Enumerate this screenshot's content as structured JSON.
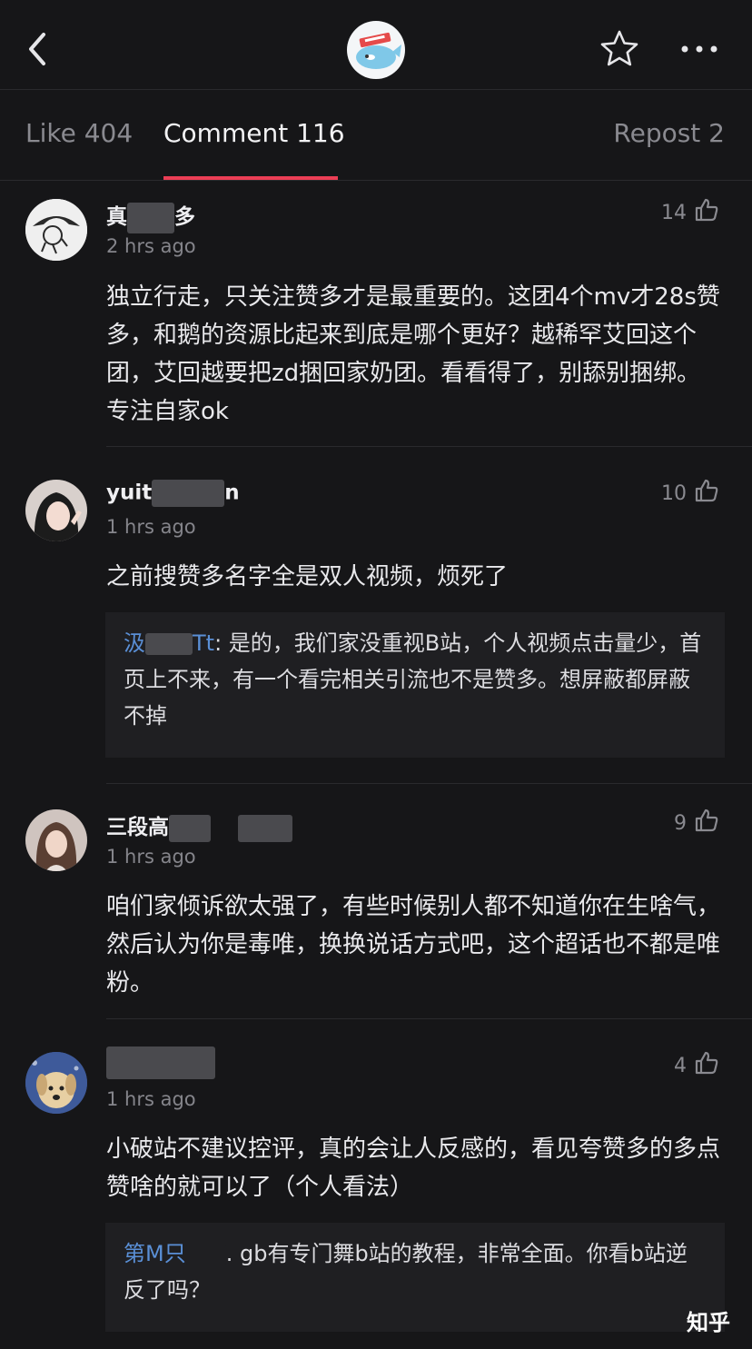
{
  "tabs": {
    "like": "Like 404",
    "comment": "Comment 116",
    "repost": "Repost 2"
  },
  "comments": [
    {
      "name_start": "真",
      "name_end": "多",
      "time": "2 hrs ago",
      "likes": "14",
      "text": "独立行走，只关注赞多才是最重要的。这团4个mv才28s赞多，和鹅的资源比起来到底是哪个更好？越稀罕艾回这个团，艾回越要把zd捆回家奶团。看看得了，别舔别捆绑。专注自家ok"
    },
    {
      "name_start": "yuit",
      "name_end": "n",
      "time": "1 hrs ago",
      "likes": "10",
      "text": "之前搜赞多名字全是双人视频，烦死了",
      "reply_user": "汲",
      "reply_user_end": "Tt",
      "reply_text": ": 是的，我们家没重视B站，个人视频点击量少，首页上不来，有一个看完相关引流也不是赞多。想屏蔽都屏蔽不掉"
    },
    {
      "name_start": "三段高",
      "name_end": "",
      "time": "1 hrs ago",
      "likes": "9",
      "text": "咱们家倾诉欲太强了，有些时候别人都不知道你在生啥气，然后认为你是毒唯，换换说话方式吧，这个超话也不都是唯粉。"
    },
    {
      "name_start": "",
      "name_end": "",
      "time": "1 hrs ago",
      "likes": "4",
      "text": "小破站不建议控评，真的会让人反感的，看见夸赞多的多点赞啥的就可以了（个人看法）",
      "reply_user": "第M只",
      "reply_user_end": "",
      "reply_text": ". gb有专门舞b站的教程，非常全面。你看b站逆反了吗？"
    }
  ],
  "watermark": "知乎",
  "icons": [
    "back-icon",
    "app-logo",
    "star-icon",
    "more-icon",
    "thumbs-up-icon"
  ],
  "colors": {
    "accent": "#ec3e55",
    "reply_name": "#5a8fd6",
    "background": "#161618"
  }
}
